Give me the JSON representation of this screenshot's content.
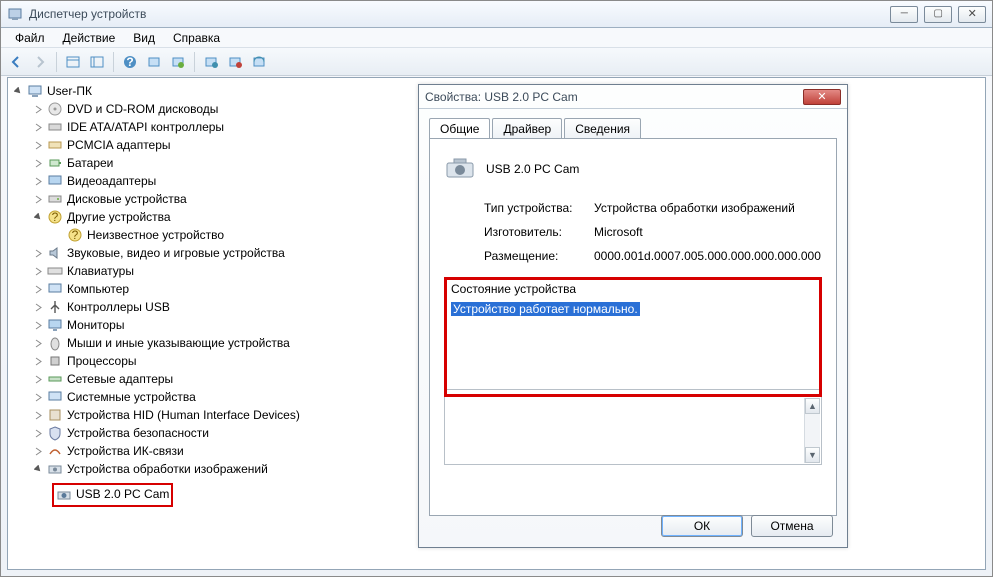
{
  "window": {
    "title": "Диспетчер устройств"
  },
  "menu": {
    "file": "Файл",
    "action": "Действие",
    "view": "Вид",
    "help": "Справка"
  },
  "tree": {
    "root": "User-ПК",
    "items": {
      "dvd": "DVD и CD-ROM дисководы",
      "ide": "IDE ATA/ATAPI контроллеры",
      "pcmcia": "PCMCIA адаптеры",
      "bat": "Батареи",
      "video": "Видеоадаптеры",
      "disk": "Дисковые устройства",
      "other": "Другие устройства",
      "unknown": "Неизвестное устройство",
      "sound": "Звуковые, видео и игровые устройства",
      "kbd": "Клавиатуры",
      "comp": "Компьютер",
      "usb": "Контроллеры USB",
      "mon": "Мониторы",
      "mouse": "Мыши и иные указывающие устройства",
      "cpu": "Процессоры",
      "net": "Сетевые адаптеры",
      "sys": "Системные устройства",
      "hid": "Устройства HID (Human Interface Devices)",
      "sec": "Устройства безопасности",
      "ir": "Устройства ИК-связи",
      "img": "Устройства обработки изображений",
      "cam": "USB 2.0 PC Cam"
    }
  },
  "dialog": {
    "title": "Свойства: USB 2.0 PC Cam",
    "tabs": {
      "general": "Общие",
      "driver": "Драйвер",
      "details": "Сведения"
    },
    "dev_name": "USB 2.0 PC Cam",
    "fields": {
      "type_k": "Тип устройства:",
      "type_v": "Устройства обработки изображений",
      "mfr_k": "Изготовитель:",
      "mfr_v": "Microsoft",
      "loc_k": "Размещение:",
      "loc_v": "0000.001d.0007.005.000.000.000.000.000"
    },
    "status_legend": "Состояние устройства",
    "status_text": "Устройство работает нормально.",
    "ok": "ОК",
    "cancel": "Отмена"
  }
}
